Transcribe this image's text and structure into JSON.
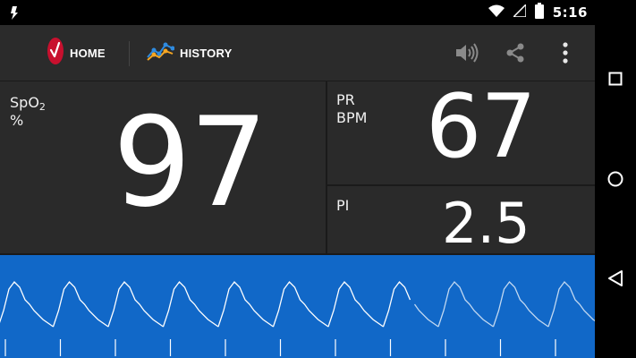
{
  "status_bar": {
    "time": "5:16",
    "icons": [
      "app-notification-icon",
      "wifi-icon",
      "signal-icon",
      "battery-icon"
    ]
  },
  "toolbar": {
    "home_label": "HOME",
    "history_label": "HISTORY",
    "icons": [
      "masimo-logo-icon",
      "history-chart-icon",
      "volume-icon",
      "share-icon",
      "overflow-menu-icon"
    ]
  },
  "readings": {
    "spo2": {
      "label": "SpO",
      "label_sub": "2",
      "unit": "%",
      "value": "97"
    },
    "pr": {
      "label": "PR",
      "unit": "BPM",
      "value": "67"
    },
    "pi": {
      "label": "PI",
      "value": "2.5"
    }
  },
  "colors": {
    "background": "#1a1a1a",
    "panel": "#2a2a2a",
    "toolbar": "#2b2b2b",
    "waveform_bg": "#1168c8",
    "brand_red": "#c8102e",
    "history_blue": "#2f8be0",
    "history_orange": "#f5a623"
  },
  "nav_bar": {
    "icons": [
      "recents-square-icon",
      "home-circle-icon",
      "back-triangle-icon"
    ]
  }
}
